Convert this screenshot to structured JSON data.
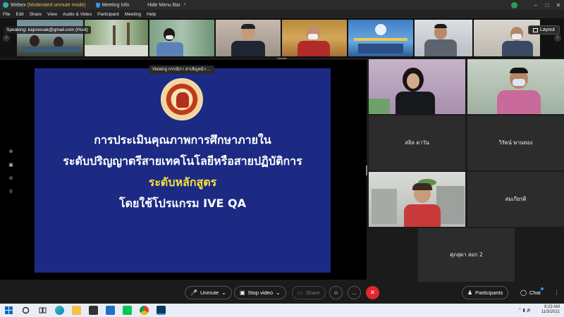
{
  "titlebar": {
    "app_name": "Webex",
    "mode": "(Moderated unmute mode)",
    "meeting_info": "Meeting Info",
    "hide_menu_bar": "Hide Menu Bar",
    "chevron": "^"
  },
  "menubar": {
    "items": [
      "File",
      "Edit",
      "Share",
      "View",
      "Audio & Video",
      "Participant",
      "Meeting",
      "Help"
    ]
  },
  "strip": {
    "speaking": "Speaking: kajonesak@gmail.com (Host)",
    "layout_label": "Layout"
  },
  "share": {
    "viewing": "Viewing กรรณิกา สาเสิญหม้ว ...",
    "slide_lines": [
      "การประเมินคุณภาพการศึกษาภายใน",
      "ระดับปริญญาตรีสายเทคโนโลยีหรือสายปฏิบัติการ",
      "ระดับหลักสูตร",
      "โดยใช้โปรแกรม IVE QA"
    ]
  },
  "participants": {
    "names": [
      "สลิล ดาวัน",
      "วิรัตน์ พานทอง",
      "สมเกียรติ",
      "ศุภสุดา สอก 2"
    ]
  },
  "toolbar": {
    "unmute": "Unmute",
    "stop_video": "Stop video",
    "share": "Share",
    "participants": "Participants",
    "chat": "Chat"
  },
  "taskbar": {
    "time": "9:23 AM",
    "date": "11/3/2021"
  },
  "icons": {
    "end_call": "x",
    "more": "...",
    "reactions": "smiley"
  },
  "colors": {
    "slide_bg": "#1d2a84",
    "slide_highlight": "#f5e23a",
    "end_call": "#e3272f",
    "mode_text": "#f2b84b"
  }
}
